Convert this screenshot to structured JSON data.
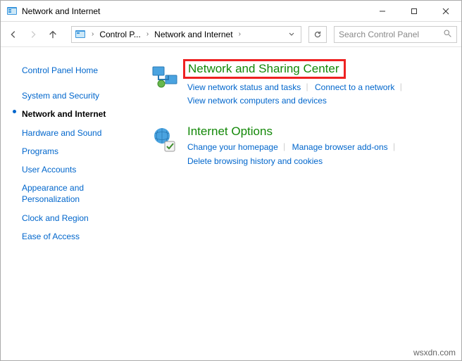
{
  "window": {
    "title": "Network and Internet"
  },
  "breadcrumb": {
    "items": [
      "Control P...",
      "Network and Internet"
    ]
  },
  "search": {
    "placeholder": "Search Control Panel"
  },
  "sidebar": {
    "items": [
      {
        "label": "Control Panel Home",
        "current": false
      },
      {
        "label": "System and Security",
        "current": false
      },
      {
        "label": "Network and Internet",
        "current": true
      },
      {
        "label": "Hardware and Sound",
        "current": false
      },
      {
        "label": "Programs",
        "current": false
      },
      {
        "label": "User Accounts",
        "current": false
      },
      {
        "label": "Appearance and Personalization",
        "current": false
      },
      {
        "label": "Clock and Region",
        "current": false
      },
      {
        "label": "Ease of Access",
        "current": false
      }
    ]
  },
  "main": {
    "sections": [
      {
        "title": "Network and Sharing Center",
        "highlight": true,
        "links": [
          "View network status and tasks",
          "Connect to a network",
          "View network computers and devices"
        ]
      },
      {
        "title": "Internet Options",
        "highlight": false,
        "links": [
          "Change your homepage",
          "Manage browser add-ons",
          "Delete browsing history and cookies"
        ]
      }
    ]
  },
  "watermark": "wsxdn.com"
}
